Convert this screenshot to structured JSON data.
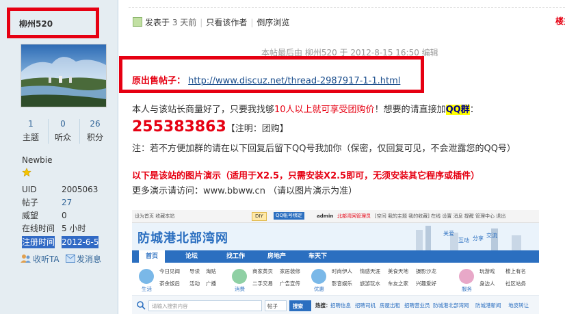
{
  "author": {
    "name": "柳州520"
  },
  "stats": [
    {
      "value": "1",
      "label": "主题"
    },
    {
      "value": "0",
      "label": "听众"
    },
    {
      "value": "26",
      "label": "积分"
    }
  ],
  "group": "Newbie",
  "info": {
    "uid_label": "UID",
    "uid": "2005063",
    "posts_label": "帖子",
    "posts": "27",
    "prestige_label": "威望",
    "prestige": "0",
    "online_label": "在线时间",
    "online": "5 小时",
    "reg_label": "注册时间",
    "reg": "2012-6-5"
  },
  "actions": {
    "follow": "收听TA",
    "message": "发消息"
  },
  "meta": {
    "posted_prefix": "发表于",
    "posted_time": "3 天前",
    "only_author": "只看该作者",
    "reverse": "倒序浏览",
    "floor": "楼主"
  },
  "edit_note": "本帖最后由 柳州520 于 2012-8-15 16:50 编辑",
  "original": {
    "label": "原出售帖子：",
    "url": "http://www.discuz.net/thread-2987917-1-1.html"
  },
  "body": {
    "l1_a": "本人与该站长商量好了，只要我找够",
    "l1_b": "10人以上就可享受团购价",
    "l1_c": "！想要的请直接加",
    "l1_d": "QQ群",
    "l1_e": "：",
    "qq_number": "255383863",
    "qq_note": "【注明：团购】",
    "l3": "注：若不方便加群的请在以下回复后留下QQ号我加你（保密，仅回复可见，不会泄露您的QQ号）",
    "l4": "以下是该站的图片演示（适用于X2.5，只需安装X2.5即可，无须安装其它程序或插件）",
    "l5": "更多演示请访问：www.bbww.cn （请以图片演示为准）"
  },
  "demo": {
    "top_links": "设为首页  收藏本站",
    "diy": "DIY",
    "qq_bind": "QQ帐号绑定",
    "user": "admin",
    "user_group": "北部湾网管理员",
    "user_links": "[空间  我的主题  我的收藏]  在线  设置  消息  提醒  管理中心  退出",
    "logo": "防城港北部湾网",
    "slogans": [
      "关爱",
      "互动",
      "分享",
      "交流"
    ],
    "nav": [
      "首页",
      "论坛",
      "找工作",
      "房地产",
      "车天下"
    ],
    "cats": [
      {
        "name": "生活",
        "items": [
          "今日见闻",
          "导读",
          "淘贴",
          "茶余饭后",
          "活动",
          "广播"
        ]
      },
      {
        "name": "消费",
        "items": [
          "商家黄页",
          "家居装修",
          "二手交易",
          "广告宣传"
        ]
      },
      {
        "name": "优惠",
        "items": [
          "时尚伊人",
          "情感天涯",
          "美食天地",
          "摄影沙龙",
          "影音娱乐",
          "旅游玩水",
          "车友之家",
          "兴趣爱好"
        ]
      },
      {
        "name": "服务",
        "items": [
          "玩游戏",
          "楼上有名",
          "身边人",
          "社区站务"
        ]
      }
    ],
    "search_placeholder": "请输入搜索内容",
    "search_type": "帖子",
    "search_btn": "搜索",
    "hot_label": "热搜：",
    "hot": [
      "招聘信息",
      "招聘司机",
      "房屋出租",
      "招聘营业员",
      "防城港北部湾网",
      "防城港新闻",
      "地皮转让"
    ]
  },
  "colors": {
    "accent_red": "#e60012",
    "sidebar_bg": "#e5edf2",
    "link_blue": "#369",
    "demo_nav_blue": "#2b6fc0"
  }
}
